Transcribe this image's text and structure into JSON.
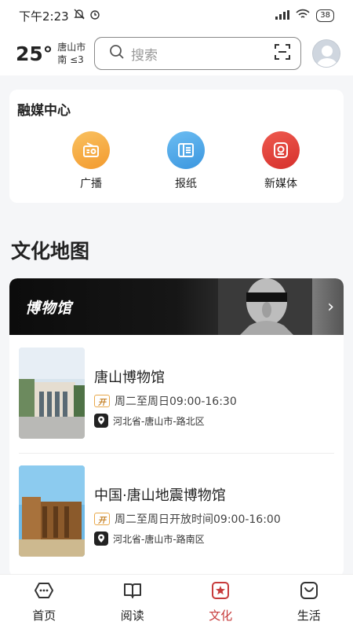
{
  "status_bar": {
    "time": "下午2:23",
    "battery": "38"
  },
  "header": {
    "temperature": "25°",
    "city": "唐山市",
    "wind": "南 ≤3",
    "search_placeholder": "搜索"
  },
  "media_center": {
    "title": "融媒中心",
    "items": [
      {
        "label": "广播",
        "icon": "radio-icon",
        "color": "#f6a73a"
      },
      {
        "label": "报纸",
        "icon": "newspaper-icon",
        "color": "#4aa6e8"
      },
      {
        "label": "新媒体",
        "icon": "new-media-icon",
        "color": "#e0413c"
      }
    ]
  },
  "culture_map": {
    "title": "文化地图",
    "banner_title": "博物馆",
    "venues": [
      {
        "name": "唐山博物馆",
        "hours": "周二至周日09:00-16:30",
        "address": "河北省-唐山市-路北区"
      },
      {
        "name": "中国·唐山地震博物馆",
        "hours": "周二至周日开放时间09:00-16:00",
        "address": "河北省-唐山市-路南区"
      }
    ],
    "open_badge": "开"
  },
  "bottom_nav": {
    "items": [
      {
        "label": "首页",
        "icon": "home-icon"
      },
      {
        "label": "阅读",
        "icon": "book-icon"
      },
      {
        "label": "文化",
        "icon": "culture-icon",
        "active": true
      },
      {
        "label": "生活",
        "icon": "life-icon"
      }
    ],
    "active_color": "#c73b3b"
  }
}
